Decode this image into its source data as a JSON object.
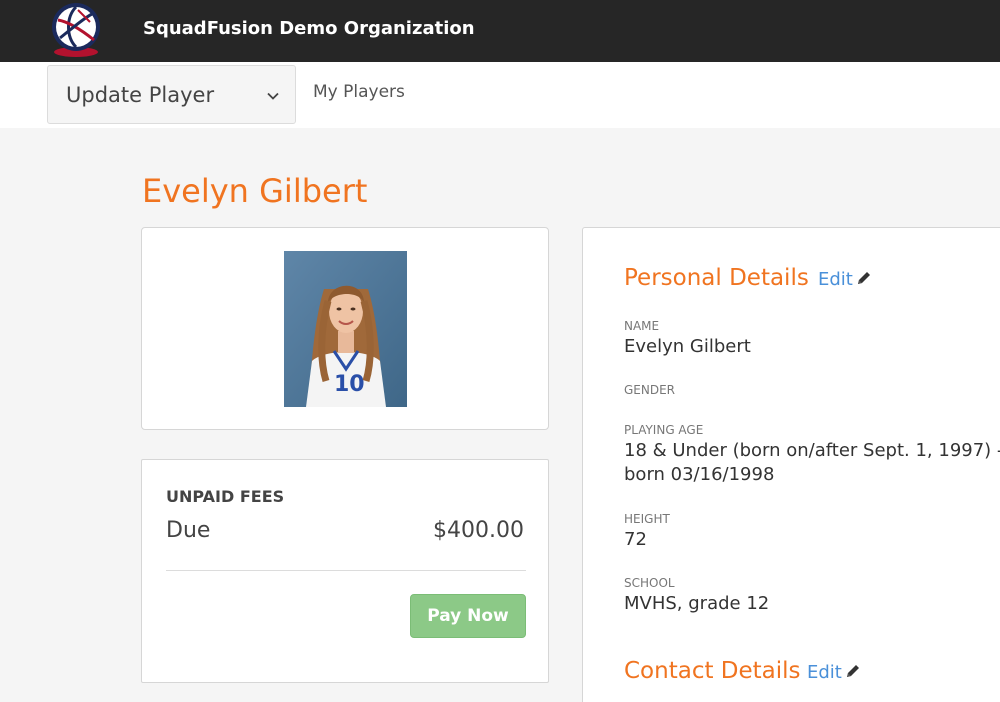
{
  "header": {
    "org_name": "SquadFusion Demo Organization",
    "logo_icon": "volleyball-logo-icon"
  },
  "subnav": {
    "select_value": "Update Player",
    "my_players": "My Players"
  },
  "player": {
    "name": "Evelyn Gilbert",
    "jersey_number": "10"
  },
  "fees": {
    "heading": "UNPAID FEES",
    "due_label": "Due",
    "due_amount": "$400.00",
    "pay_label": "Pay Now"
  },
  "personal_details": {
    "heading": "Personal Details",
    "edit_label": "Edit",
    "name_label": "NAME",
    "name_value": "Evelyn Gilbert",
    "gender_label": "GENDER",
    "playing_age_label": "PLAYING AGE",
    "playing_age_line1": "18 & Under (born on/after Sept. 1, 1997) -",
    "playing_age_line2": "born 03/16/1998",
    "height_label": "HEIGHT",
    "height_value": "72",
    "school_label": "SCHOOL",
    "school_value": "MVHS, grade 12"
  },
  "contact_details": {
    "heading": "Contact Details",
    "edit_label": "Edit"
  },
  "colors": {
    "accent_orange": "#f07420",
    "link_blue": "#4a90d9",
    "pay_green": "#8cc987",
    "topbar": "#262626"
  }
}
